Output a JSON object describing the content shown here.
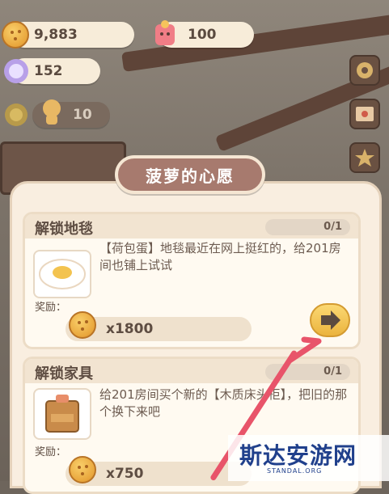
{
  "currencies": {
    "coins": "9,883",
    "hearts": "100",
    "gems": "152",
    "level": "10"
  },
  "panel": {
    "title": "菠萝的心愿"
  },
  "tasks": [
    {
      "title": "解锁地毯",
      "progress": "0/1",
      "description": "【荷包蛋】地毯最近在网上挺红的，给201房间也铺上试试",
      "reward_label": "奖励：",
      "reward_amount": "x1800",
      "thumb_icon": "fried-egg-icon"
    },
    {
      "title": "解锁家具",
      "progress": "0/1",
      "description": "给201房间买个新的【木质床头柜】，把旧的那个换下来吧",
      "reward_label": "奖励：",
      "reward_amount": "x750",
      "thumb_icon": "nightstand-icon"
    }
  ],
  "watermark": {
    "title": "斯达安游网",
    "subtitle": "STANDAL.ORG"
  },
  "colors": {
    "accent": "#a77a6e",
    "arrow": "#e8546a",
    "coin": "#e9a63c"
  }
}
